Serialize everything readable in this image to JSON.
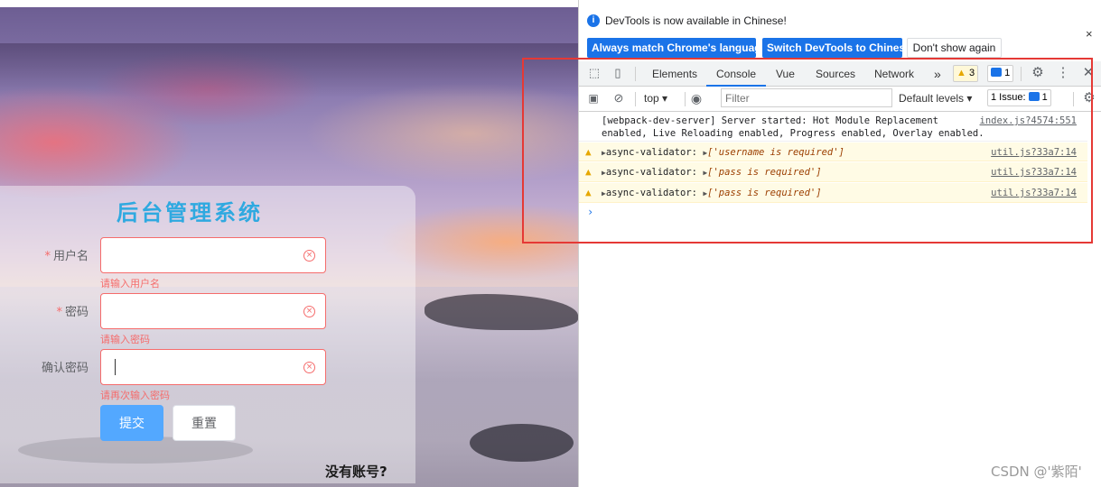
{
  "login": {
    "title": "后台管理系统",
    "username_label": "用户名",
    "username_error": "请输入用户名",
    "password_label": "密码",
    "password_error": "请输入密码",
    "confirm_label": "确认密码",
    "confirm_error": "请再次输入密码",
    "required_mark": "*",
    "submit_label": "提交",
    "reset_label": "重置",
    "no_account": "没有账号?"
  },
  "devtools": {
    "info_text": "DevTools is now available in Chinese!",
    "btn_match": "Always match Chrome's language",
    "btn_switch": "Switch DevTools to Chinese",
    "btn_dont": "Don't show again",
    "close": "×",
    "tabs": [
      "Elements",
      "Console",
      "Vue",
      "Sources",
      "Network"
    ],
    "more_tabs": "»",
    "warn_count": "3",
    "msg_count": "1",
    "context": "top",
    "filter_placeholder": "Filter",
    "levels": "Default levels",
    "issues": "1 Issue:",
    "issues_count": "1",
    "logs": [
      {
        "text": "[webpack-dev-server] Server started: Hot Module Replacement\nenabled, Live Reloading enabled, Progress enabled, Overlay enabled.",
        "src": "index.js?4574:551"
      },
      {
        "prefix": "async-validator:",
        "value": "['username is required']",
        "src": "util.js?33a7:14"
      },
      {
        "prefix": "async-validator:",
        "value": "['pass is required']",
        "src": "util.js?33a7:14"
      },
      {
        "prefix": "async-validator:",
        "value": "['pass is required']",
        "src": "util.js?33a7:14"
      }
    ],
    "prompt": "›"
  },
  "watermark": "CSDN @'紫陌'",
  "colors": {
    "accent": "#1a73e8",
    "error": "#f56c6c",
    "primary_button": "#53a8ff",
    "highlight_box": "#e53935",
    "title": "#2fa9e0"
  }
}
